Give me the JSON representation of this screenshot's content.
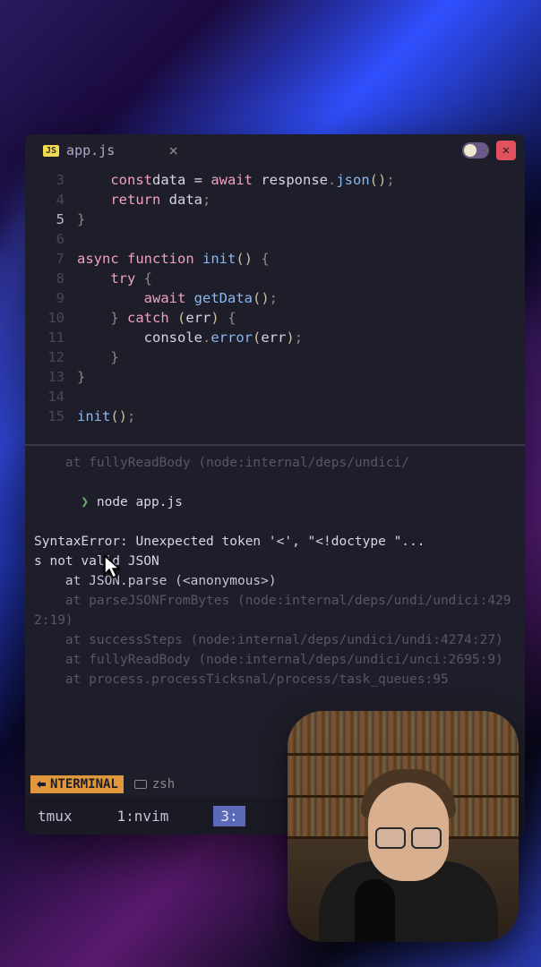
{
  "tab": {
    "icon_text": "JS",
    "filename": "app.js"
  },
  "code": {
    "lines": [
      {
        "n": "3",
        "indent": "    ",
        "tokens": [
          [
            "kw-const",
            "const"
          ],
          [
            "",
            ""
          ],
          [
            "var",
            "data"
          ],
          [
            "",
            " = "
          ],
          [
            "kw-await",
            "await"
          ],
          [
            "",
            " "
          ],
          [
            "var",
            "response"
          ],
          [
            "dot",
            "."
          ],
          [
            "fn-call",
            "json"
          ],
          [
            "paren",
            "()"
          ],
          [
            "punct",
            ";"
          ]
        ]
      },
      {
        "n": "4",
        "indent": "    ",
        "tokens": [
          [
            "kw-return",
            "return"
          ],
          [
            "",
            " "
          ],
          [
            "var",
            "data"
          ],
          [
            "punct",
            ";"
          ]
        ]
      },
      {
        "n": "5",
        "indent": "",
        "current": true,
        "tokens": [
          [
            "brace",
            "}"
          ]
        ]
      },
      {
        "n": "6",
        "indent": "",
        "tokens": []
      },
      {
        "n": "7",
        "indent": "",
        "tokens": [
          [
            "kw-async",
            "async"
          ],
          [
            "",
            " "
          ],
          [
            "kw-function",
            "function"
          ],
          [
            "",
            " "
          ],
          [
            "fn-name",
            "init"
          ],
          [
            "paren",
            "()"
          ],
          [
            "",
            " "
          ],
          [
            "brace",
            "{"
          ]
        ]
      },
      {
        "n": "8",
        "indent": "    ",
        "tokens": [
          [
            "kw-try",
            "try"
          ],
          [
            "",
            " "
          ],
          [
            "brace",
            "{"
          ]
        ]
      },
      {
        "n": "9",
        "indent": "        ",
        "tokens": [
          [
            "kw-await",
            "await"
          ],
          [
            "",
            " "
          ],
          [
            "fn-call",
            "getData"
          ],
          [
            "paren",
            "()"
          ],
          [
            "punct",
            ";"
          ]
        ]
      },
      {
        "n": "10",
        "indent": "    ",
        "tokens": [
          [
            "brace",
            "}"
          ],
          [
            "",
            " "
          ],
          [
            "kw-catch",
            "catch"
          ],
          [
            "",
            " "
          ],
          [
            "paren",
            "("
          ],
          [
            "var",
            "err"
          ],
          [
            "paren",
            ")"
          ],
          [
            "",
            " "
          ],
          [
            "brace",
            "{"
          ]
        ]
      },
      {
        "n": "11",
        "indent": "        ",
        "tokens": [
          [
            "var",
            "console"
          ],
          [
            "dot",
            "."
          ],
          [
            "fn-call",
            "error"
          ],
          [
            "paren",
            "("
          ],
          [
            "var",
            "err"
          ],
          [
            "paren",
            ")"
          ],
          [
            "punct",
            ";"
          ]
        ]
      },
      {
        "n": "12",
        "indent": "    ",
        "tokens": [
          [
            "brace",
            "}"
          ]
        ]
      },
      {
        "n": "13",
        "indent": "",
        "tokens": [
          [
            "brace",
            "}"
          ]
        ]
      },
      {
        "n": "14",
        "indent": "",
        "tokens": []
      },
      {
        "n": "15",
        "indent": "",
        "tokens": [
          [
            "fn-call",
            "init"
          ],
          [
            "paren",
            "()"
          ],
          [
            "punct",
            ";"
          ]
        ]
      }
    ]
  },
  "terminal": {
    "prev_trace": "    at fullyReadBody (node:internal/deps/undici/",
    "prompt": "❯",
    "command": "node app.js",
    "error_line1": "SyntaxError: Unexpected token '<', \"<!doctype \"...",
    "error_line2": "s not valid JSON",
    "trace1": "    at JSON.parse (<anonymous>)",
    "trace2": "    at parseJSONFromBytes (node:internal/deps/undi/undici:4292:19)",
    "trace3": "    at successSteps (node:internal/deps/undici/undi:4274:27)",
    "trace4": "    at fullyReadBody (node:internal/deps/undici/unci:2695:9)",
    "trace5": "    at process.processTicksnal/process/task_queues:95"
  },
  "status": {
    "mode": "NTERMINAL",
    "shell": "zsh"
  },
  "tmux": {
    "session": "tmux",
    "window1": "1:nvim",
    "window_active": "3:"
  }
}
